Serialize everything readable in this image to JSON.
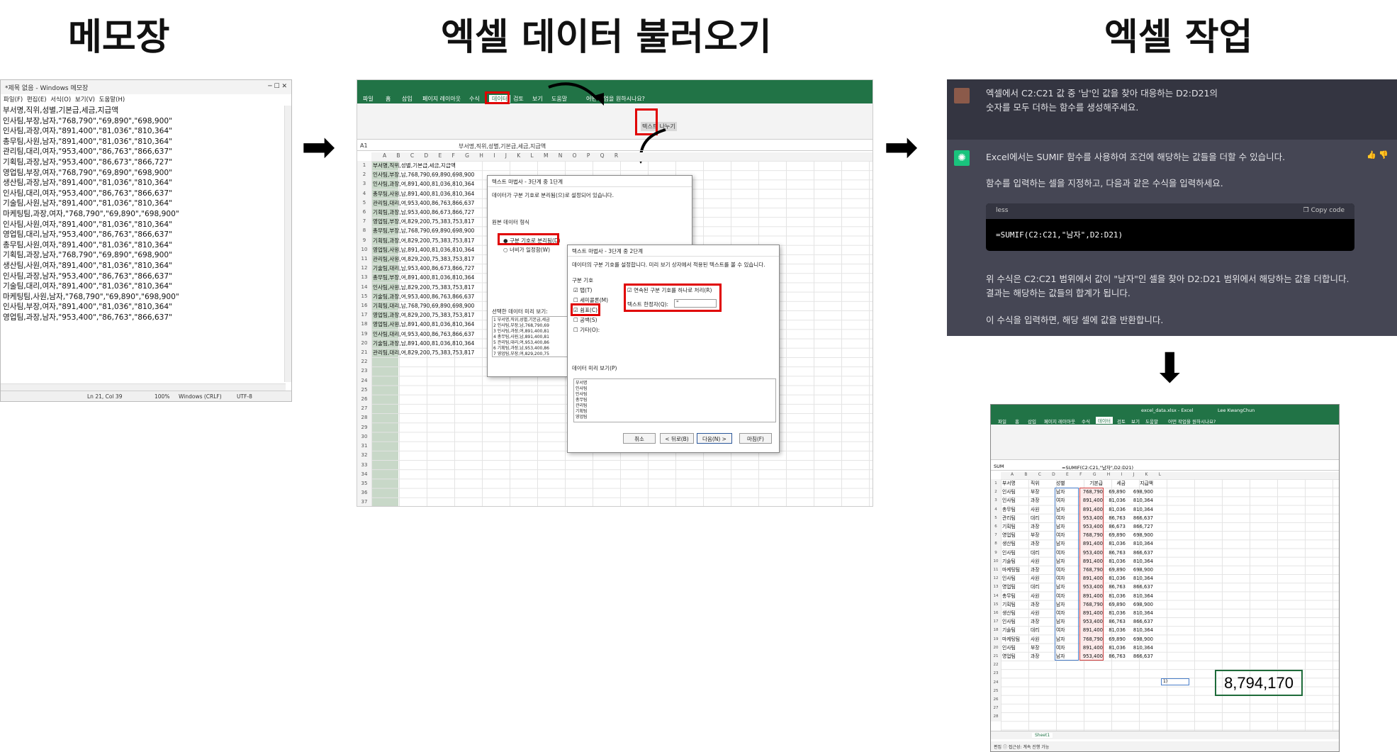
{
  "titles": {
    "notepad": "메모장",
    "import": "엑셀 데이터 불러오기",
    "work": "엑셀 작업"
  },
  "arrows": {
    "right": "➡",
    "down": "⬇"
  },
  "notepad": {
    "title": "*제목 없음 - Windows 메모장",
    "controls": "─   ☐   ✕",
    "menu": "파일(F) 편집(E) 서식(O) 보기(V) 도움말(H)",
    "lines": [
      "부서명,직위,성별,기본급,세금,지급액",
      "인사팀,부장,남자,\"768,790\",\"69,890\",\"698,900\"",
      "인사팀,과장,여자,\"891,400\",\"81,036\",\"810,364\"",
      "총무팀,사원,남자,\"891,400\",\"81,036\",\"810,364\"",
      "관리팀,대리,여자,\"953,400\",\"86,763\",\"866,637\"",
      "기획팀,과장,남자,\"953,400\",\"86,673\",\"866,727\"",
      "영업팀,부장,여자,\"768,790\",\"69,890\",\"698,900\"",
      "생산팀,과장,남자,\"891,400\",\"81,036\",\"810,364\"",
      "인사팀,대리,여자,\"953,400\",\"86,763\",\"866,637\"",
      "기술팀,사원,남자,\"891,400\",\"81,036\",\"810,364\"",
      "마케팅팀,과장,여자,\"768,790\",\"69,890\",\"698,900\"",
      "인사팀,사원,여자,\"891,400\",\"81,036\",\"810,364\"",
      "영업팀,대리,남자,\"953,400\",\"86,763\",\"866,637\"",
      "총무팀,사원,여자,\"891,400\",\"81,036\",\"810,364\"",
      "기획팀,과장,남자,\"768,790\",\"69,890\",\"698,900\"",
      "생산팀,사원,여자,\"891,400\",\"81,036\",\"810,364\"",
      "인사팀,과장,남자,\"953,400\",\"86,763\",\"866,637\"",
      "기술팀,대리,여자,\"891,400\",\"81,036\",\"810,364\"",
      "마케팅팀,사원,남자,\"768,790\",\"69,890\",\"698,900\"",
      "인사팀,부장,여자,\"891,400\",\"81,036\",\"810,364\"",
      "영업팀,과장,남자,\"953,400\",\"86,763\",\"866,637\""
    ],
    "status": {
      "pos": "Ln 21, Col 39",
      "zoom": "100%",
      "eol": "Windows (CRLF)",
      "enc": "UTF-8"
    }
  },
  "excel1": {
    "tabs": [
      "파일",
      "홈",
      "삽입",
      "페이지 레이아웃",
      "수식",
      "데이터",
      "검토",
      "보기",
      "도움말"
    ],
    "active_tab": "데이터",
    "search": "어떤 작업을 원하시나요?",
    "namebox": "A1",
    "formula": "부서명,직위,성별,기본급,세금,지급액",
    "text_to_columns": "텍스트 나누기",
    "cols": "A      B      C      D      E      F      G      H      I      J      K      L      M      N      O      P      Q      R",
    "row_nums": "1\n2\n3\n4\n5\n6\n7\n8\n9\n10\n11\n12\n13\n14\n15\n16\n17\n18\n19\n20\n21\n22\n23\n24\n25\n26\n27\n28\n29\n30\n31\n32\n33\n34\n35\n36\n37\n38",
    "rows_text": "부서명,직위,성별,기본급,세금,지급액\n인사팀,부장,남,768,790,69,890,698,900\n인사팀,과장,여,891,400,81,036,810,364\n총무팀,사원,남,891,400,81,036,810,364\n관리팀,대리,여,953,400,86,763,866,637\n기획팀,과장,남,953,400,86,673,866,727\n영업팀,부장,여,829,200,75,383,753,817\n총무팀,부장,남,768,790,69,890,698,900\n기획팀,과장,여,829,200,75,383,753,817\n영업팀,사원,남,891,400,81,036,810,364\n관리팀,사원,여,829,200,75,383,753,817\n기술팀,대리,남,953,400,86,673,866,727\n총무팀,부장,여,891,400,81,036,810,364\n인사팀,사원,남,829,200,75,383,753,817\n기술팀,과장,여,953,400,86,763,866,637\n기획팀,대리,남,768,790,69,890,698,900\n영업팀,과장,여,829,200,75,383,753,817\n영업팀,사원,남,891,400,81,036,810,364\n인사팀,대리,여,953,400,86,763,866,637\n기술팀,과장,남,891,400,81,036,810,364\n관리팀,대리,여,829,200,75,383,753,817",
    "wizard1": {
      "title": "텍스트 마법사 - 3단계 중 1단계",
      "desc": "데이터가 구분 기호로 분리됨(으)로 설정되어 있습니다.",
      "orig_type": "원본 데이터 형식",
      "opt_delim": "구분 기호로 분리됨(D)",
      "opt_fixed": "너비가 일정함(W)",
      "preview": "선택한 데이터 미리 보기:",
      "preview_lines": "1 부서명,직위,성별,기본급,세금\n2 인사팀,부장,남,768,790,69\n3 인사팀,과장,여,891,400,81\n4 총무팀,사원,남,891,400,81\n5 관리팀,대리,여,953,400,86\n6 기획팀,과장,남,953,400,86\n7 영업팀,부장,여,829,200,75"
    },
    "wizard2": {
      "title": "텍스트 마법사 - 3단계 중 2단계",
      "desc": "데이터의 구분 기호를 설정합니다. 미리 보기 상자에서 적용된 텍스트를 볼 수 있습니다.",
      "delims": "구분 기호",
      "tab": "탭(T)",
      "semicolon": "세미콜론(M)",
      "comma": "쉼표(C)",
      "space": "공백(S)",
      "other": "기타(O):",
      "consecutive": "연속된 구분 기호를 하나로 처리(R)",
      "qualifier": "텍스트 한정자(Q):",
      "qualifier_val": "\"",
      "preview": "데이터 미리 보기(P)",
      "preview_lines": "부서명\n인사팀\n인사팀\n총무팀\n관리팀\n기획팀\n영업팀",
      "cancel": "취소",
      "back": "< 뒤로(B)",
      "next": "다음(N) >",
      "finish": "마침(F)"
    }
  },
  "chat": {
    "user_msg": [
      "엑셀에서 C2:C21 값 중 '남'인 값을 찾아 대응하는 D2:D21의",
      "숫자를 모두 더하는 함수를 생성해주세요."
    ],
    "reply1": "Excel에서는 SUMIF 함수를 사용하여 조건에 해당하는 값들을 더할 수 있습니다.",
    "reply2": "함수를 입력하는 셀을 지정하고, 다음과 같은 수식을 입력하세요.",
    "code_lang": "less",
    "copy": "Copy code",
    "code": "=SUMIF(C2:C21,\"남자\",D2:D21)",
    "reply3a": "위 수식은 C2:C21 범위에서 값이 \"남자\"인 셀을 찾아 D2:D21 범위에서 해당하는 값을 더합니다.",
    "reply3b": "결과는 해당하는 값들의 합계가 됩니다.",
    "reply4": "이 수식을 입력하면, 해당 셀에 값을 반환합니다."
  },
  "excel2": {
    "filename": "excel_data.xlsx  -  Excel",
    "user": "Lee KwangChun",
    "namebox": "SUM",
    "formula": "=SUMIF(C2:C21,\"남자\",D2:D21)",
    "tabs": [
      "파일",
      "홈",
      "삽입",
      "페이지 레이아웃",
      "수식",
      "데이터",
      "검토",
      "보기",
      "도움말"
    ],
    "search": "어떤 작업을 원하시나요?",
    "cols": "A        B        C        D        E        F        G        H        I        J        K        L",
    "row_nums": "1\n2\n3\n4\n5\n6\n7\n8\n9\n10\n11\n12\n13\n14\n15\n16\n17\n18\n19\n20\n21\n22\n23\n24\n25\n26\n27\n28",
    "col_a": "부서명\n인사팀\n인사팀\n총무팀\n관리팀\n기획팀\n영업팀\n생산팀\n인사팀\n기술팀\n마케팅팀\n인사팀\n영업팀\n총무팀\n기획팀\n생산팀\n인사팀\n기술팀\n마케팅팀\n인사팀\n영업팀",
    "col_b": "직위\n부장\n과장\n사원\n대리\n과장\n부장\n과장\n대리\n사원\n과장\n사원\n대리\n사원\n과장\n사원\n과장\n대리\n사원\n부장\n과장",
    "col_c": "성별\n남자\n여자\n남자\n여자\n남자\n여자\n남자\n여자\n남자\n여자\n여자\n남자\n여자\n남자\n여자\n남자\n여자\n남자\n여자\n남자",
    "col_d": "기본급\n768,790\n891,400\n891,400\n953,400\n953,400\n768,790\n891,400\n953,400\n891,400\n768,790\n891,400\n953,400\n891,400\n768,790\n891,400\n953,400\n891,400\n768,790\n891,400\n953,400",
    "col_e": "세금\n69,890\n81,036\n81,036\n86,763\n86,673\n69,890\n81,036\n86,763\n81,036\n69,890\n81,036\n86,763\n81,036\n69,890\n81,036\n86,763\n81,036\n69,890\n81,036\n86,763",
    "col_f": "지급액\n698,900\n810,364\n810,364\n866,637\n866,727\n698,900\n810,364\n866,637\n810,364\n698,900\n810,364\n866,637\n810,364\n698,900\n810,364\n866,637\n810,364\n698,900\n810,364\n866,637",
    "tooltip": "1)",
    "result": "8,794,170",
    "sheet": "Sheet1",
    "status": "편집  ⓘ 접근성: 계속 진행 가능"
  }
}
